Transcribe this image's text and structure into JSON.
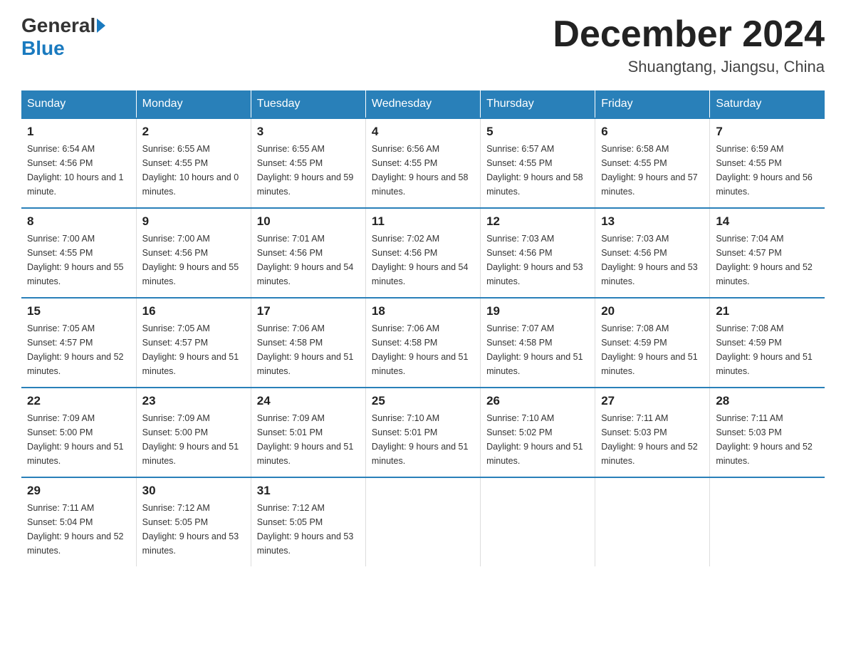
{
  "header": {
    "logo_general": "General",
    "logo_blue": "Blue",
    "month_title": "December 2024",
    "location": "Shuangtang, Jiangsu, China"
  },
  "days_of_week": [
    "Sunday",
    "Monday",
    "Tuesday",
    "Wednesday",
    "Thursday",
    "Friday",
    "Saturday"
  ],
  "weeks": [
    [
      {
        "day": "1",
        "sunrise": "6:54 AM",
        "sunset": "4:56 PM",
        "daylight": "10 hours and 1 minute."
      },
      {
        "day": "2",
        "sunrise": "6:55 AM",
        "sunset": "4:55 PM",
        "daylight": "10 hours and 0 minutes."
      },
      {
        "day": "3",
        "sunrise": "6:55 AM",
        "sunset": "4:55 PM",
        "daylight": "9 hours and 59 minutes."
      },
      {
        "day": "4",
        "sunrise": "6:56 AM",
        "sunset": "4:55 PM",
        "daylight": "9 hours and 58 minutes."
      },
      {
        "day": "5",
        "sunrise": "6:57 AM",
        "sunset": "4:55 PM",
        "daylight": "9 hours and 58 minutes."
      },
      {
        "day": "6",
        "sunrise": "6:58 AM",
        "sunset": "4:55 PM",
        "daylight": "9 hours and 57 minutes."
      },
      {
        "day": "7",
        "sunrise": "6:59 AM",
        "sunset": "4:55 PM",
        "daylight": "9 hours and 56 minutes."
      }
    ],
    [
      {
        "day": "8",
        "sunrise": "7:00 AM",
        "sunset": "4:55 PM",
        "daylight": "9 hours and 55 minutes."
      },
      {
        "day": "9",
        "sunrise": "7:00 AM",
        "sunset": "4:56 PM",
        "daylight": "9 hours and 55 minutes."
      },
      {
        "day": "10",
        "sunrise": "7:01 AM",
        "sunset": "4:56 PM",
        "daylight": "9 hours and 54 minutes."
      },
      {
        "day": "11",
        "sunrise": "7:02 AM",
        "sunset": "4:56 PM",
        "daylight": "9 hours and 54 minutes."
      },
      {
        "day": "12",
        "sunrise": "7:03 AM",
        "sunset": "4:56 PM",
        "daylight": "9 hours and 53 minutes."
      },
      {
        "day": "13",
        "sunrise": "7:03 AM",
        "sunset": "4:56 PM",
        "daylight": "9 hours and 53 minutes."
      },
      {
        "day": "14",
        "sunrise": "7:04 AM",
        "sunset": "4:57 PM",
        "daylight": "9 hours and 52 minutes."
      }
    ],
    [
      {
        "day": "15",
        "sunrise": "7:05 AM",
        "sunset": "4:57 PM",
        "daylight": "9 hours and 52 minutes."
      },
      {
        "day": "16",
        "sunrise": "7:05 AM",
        "sunset": "4:57 PM",
        "daylight": "9 hours and 51 minutes."
      },
      {
        "day": "17",
        "sunrise": "7:06 AM",
        "sunset": "4:58 PM",
        "daylight": "9 hours and 51 minutes."
      },
      {
        "day": "18",
        "sunrise": "7:06 AM",
        "sunset": "4:58 PM",
        "daylight": "9 hours and 51 minutes."
      },
      {
        "day": "19",
        "sunrise": "7:07 AM",
        "sunset": "4:58 PM",
        "daylight": "9 hours and 51 minutes."
      },
      {
        "day": "20",
        "sunrise": "7:08 AM",
        "sunset": "4:59 PM",
        "daylight": "9 hours and 51 minutes."
      },
      {
        "day": "21",
        "sunrise": "7:08 AM",
        "sunset": "4:59 PM",
        "daylight": "9 hours and 51 minutes."
      }
    ],
    [
      {
        "day": "22",
        "sunrise": "7:09 AM",
        "sunset": "5:00 PM",
        "daylight": "9 hours and 51 minutes."
      },
      {
        "day": "23",
        "sunrise": "7:09 AM",
        "sunset": "5:00 PM",
        "daylight": "9 hours and 51 minutes."
      },
      {
        "day": "24",
        "sunrise": "7:09 AM",
        "sunset": "5:01 PM",
        "daylight": "9 hours and 51 minutes."
      },
      {
        "day": "25",
        "sunrise": "7:10 AM",
        "sunset": "5:01 PM",
        "daylight": "9 hours and 51 minutes."
      },
      {
        "day": "26",
        "sunrise": "7:10 AM",
        "sunset": "5:02 PM",
        "daylight": "9 hours and 51 minutes."
      },
      {
        "day": "27",
        "sunrise": "7:11 AM",
        "sunset": "5:03 PM",
        "daylight": "9 hours and 52 minutes."
      },
      {
        "day": "28",
        "sunrise": "7:11 AM",
        "sunset": "5:03 PM",
        "daylight": "9 hours and 52 minutes."
      }
    ],
    [
      {
        "day": "29",
        "sunrise": "7:11 AM",
        "sunset": "5:04 PM",
        "daylight": "9 hours and 52 minutes."
      },
      {
        "day": "30",
        "sunrise": "7:12 AM",
        "sunset": "5:05 PM",
        "daylight": "9 hours and 53 minutes."
      },
      {
        "day": "31",
        "sunrise": "7:12 AM",
        "sunset": "5:05 PM",
        "daylight": "9 hours and 53 minutes."
      },
      null,
      null,
      null,
      null
    ]
  ]
}
